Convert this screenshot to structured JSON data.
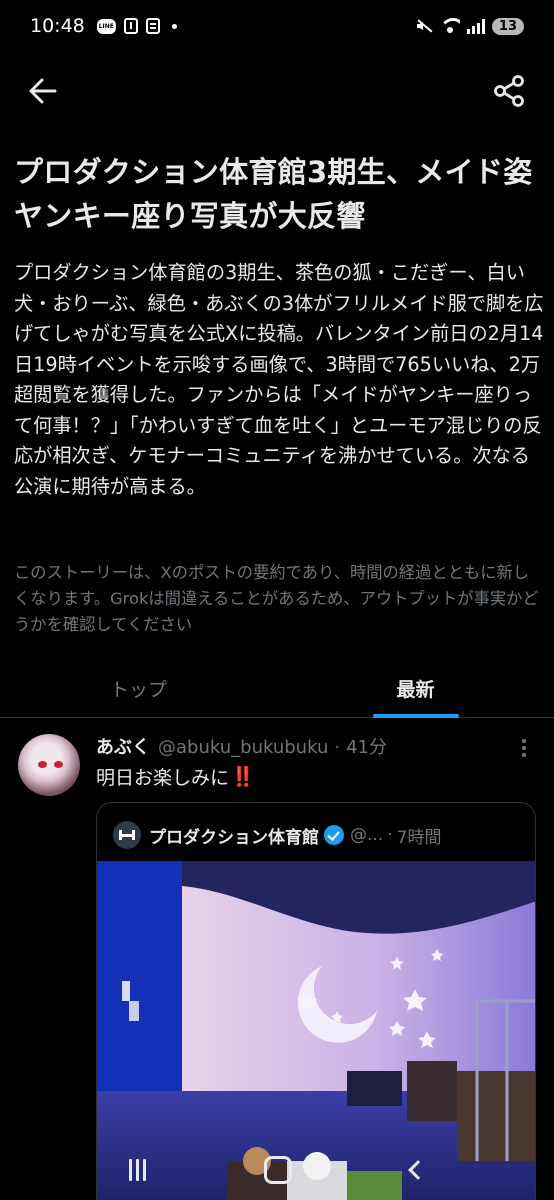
{
  "status_bar": {
    "time": "10:48",
    "line_badge": "LINE",
    "battery": "13"
  },
  "header": {
    "back_icon": "arrow-left-icon",
    "share_icon": "share-icon"
  },
  "story": {
    "headline": "プロダクション体育館3期生、メイド姿ヤンキー座り写真が大反響",
    "summary": "プロダクション体育館の3期生、茶色の狐・こだぎー、白い犬・おりーぶ、緑色・あぶくの3体がフリルメイド服で脚を広げてしゃがむ写真を公式Xに投稿。バレンタイン前日の2月14日19時イベントを示唆する画像で、3時間で765いいね、2万超閲覧を獲得した。ファンからは「メイドがヤンキー座りって何事！？」「かわいすぎて血を吐く」とユーモア混じりの反応が相次ぎ、ケモナーコミュニティを沸かせている。次なる公演に期待が高まる。",
    "disclaimer": "このストーリーは、Xのポストの要約であり、時間の経過とともに新しくなります。Grokは間違えることがあるため、アウトプットが事実かどうかを確認してください"
  },
  "tabs": [
    {
      "label": "トップ",
      "active": false
    },
    {
      "label": "最新",
      "active": true
    }
  ],
  "post": {
    "name": "あぶく",
    "handle": "@abuku_bukubuku",
    "separator": "·",
    "time": "41分",
    "text": "明日お楽しみに",
    "emoji": "‼️",
    "quote": {
      "name": "プロダクション体育館",
      "handle": "@...",
      "separator": "·",
      "time": "7時間"
    }
  },
  "colors": {
    "background": "#000000",
    "text": "#e7e9ea",
    "muted": "#71767b",
    "accent": "#1d9bf0",
    "divider": "#2f3336"
  }
}
